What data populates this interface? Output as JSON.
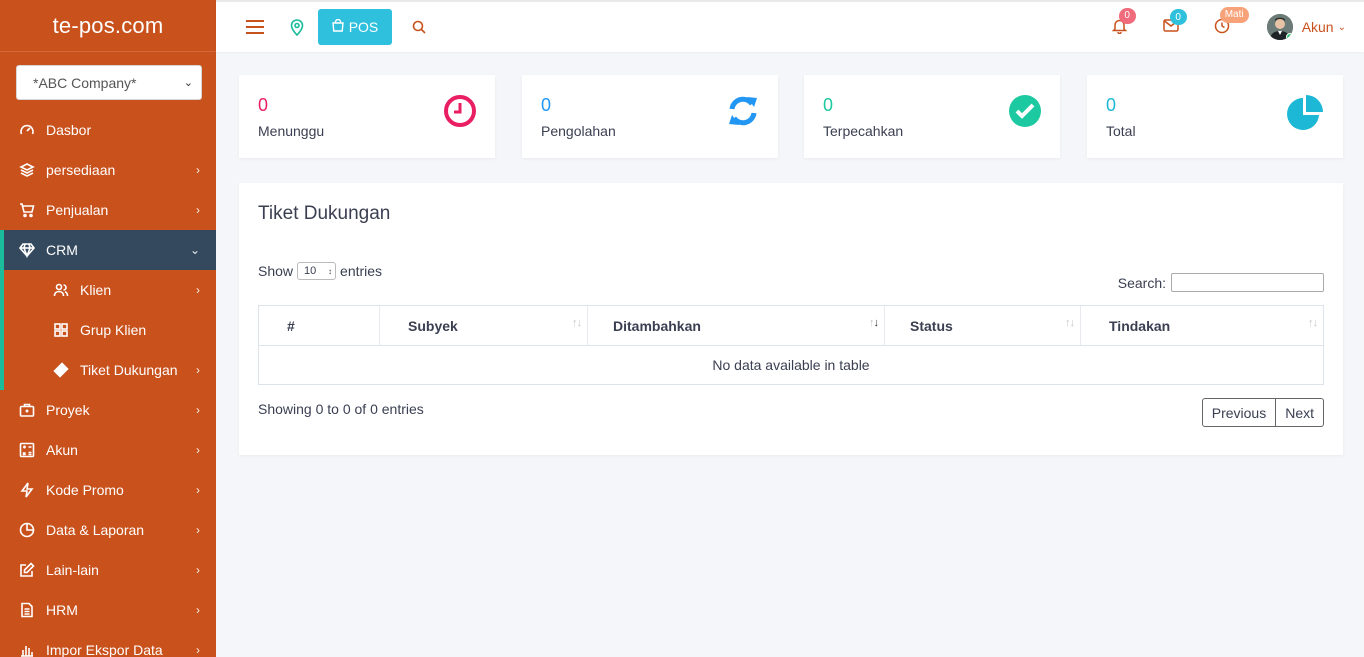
{
  "brand": "te-pos.com",
  "company_select": "*ABC Company*",
  "sidebar": {
    "items": [
      {
        "label": "Dasbor",
        "icon": "dashboard-icon"
      },
      {
        "label": "persediaan",
        "icon": "layers-icon"
      },
      {
        "label": "Penjualan",
        "icon": "cart-icon"
      },
      {
        "label": "CRM",
        "icon": "diamond-icon"
      },
      {
        "label": "Klien",
        "icon": "users-icon"
      },
      {
        "label": "Grup Klien",
        "icon": "grid-icon"
      },
      {
        "label": "Tiket Dukungan",
        "icon": "ticket-icon"
      },
      {
        "label": "Proyek",
        "icon": "briefcase-icon"
      },
      {
        "label": "Akun",
        "icon": "calculator-icon"
      },
      {
        "label": "Kode Promo",
        "icon": "bolt-icon"
      },
      {
        "label": "Data & Laporan",
        "icon": "pie-icon"
      },
      {
        "label": "Lain-lain",
        "icon": "edit-icon"
      },
      {
        "label": "HRM",
        "icon": "document-icon"
      },
      {
        "label": "Impor Ekspor Data",
        "icon": "bar-chart-icon"
      }
    ]
  },
  "topbar": {
    "pos_label": "POS",
    "notifications_count": "0",
    "messages_count": "0",
    "timer_badge": "Mati",
    "account_label": "Akun"
  },
  "stats": [
    {
      "value": "0",
      "label": "Menunggu",
      "color": "#e91e63",
      "icon": "clock-icon"
    },
    {
      "value": "0",
      "label": "Pengolahan",
      "color": "#2196f3",
      "icon": "refresh-icon"
    },
    {
      "value": "0",
      "label": "Terpecahkan",
      "color": "#1dc9a0",
      "icon": "check-circle-icon"
    },
    {
      "value": "0",
      "label": "Total",
      "color": "#1cb8d6",
      "icon": "pie-chart-icon"
    }
  ],
  "panel": {
    "title": "Tiket Dukungan",
    "show_label": "Show",
    "entries_value": "10",
    "entries_label": "entries",
    "search_label": "Search:",
    "columns": [
      "#",
      "Subyek",
      "Ditambahkan",
      "Status",
      "Tindakan"
    ],
    "empty_text": "No data available in table",
    "showing_text": "Showing 0 to 0 of 0 entries",
    "prev_label": "Previous",
    "next_label": "Next"
  },
  "colors": {
    "sidebar": "#c9511c",
    "active_item": "#34495e",
    "accent": "#1abc9c",
    "pos_button": "#2ec0dc"
  }
}
